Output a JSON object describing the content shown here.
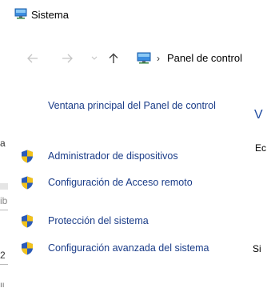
{
  "window": {
    "title": "Sistema",
    "address": {
      "separator": "›",
      "path": "Panel de control"
    }
  },
  "sidebar": {
    "home_link": "Ventana principal del Panel de control",
    "items": [
      {
        "label": "Administrador de dispositivos",
        "icon": "uac-shield-icon"
      },
      {
        "label": "Configuración de Acceso remoto",
        "icon": "uac-shield-icon"
      },
      {
        "label": "Protección del sistema",
        "icon": "uac-shield-icon"
      },
      {
        "label": "Configuración avanzada del sistema",
        "icon": "uac-shield-icon"
      }
    ]
  },
  "content_fragments": {
    "heading": "V",
    "edition": "Ec",
    "system": "Si"
  },
  "background_window": {
    "fragments": [
      "a",
      "ib",
      "2",
      "ıı"
    ]
  },
  "colors": {
    "link": "#1a3c88",
    "heading": "#1e4aa0",
    "nav_disabled": "#c4c4c4",
    "shield_blue": "#2b5bb8",
    "shield_yellow": "#f2c21b"
  }
}
